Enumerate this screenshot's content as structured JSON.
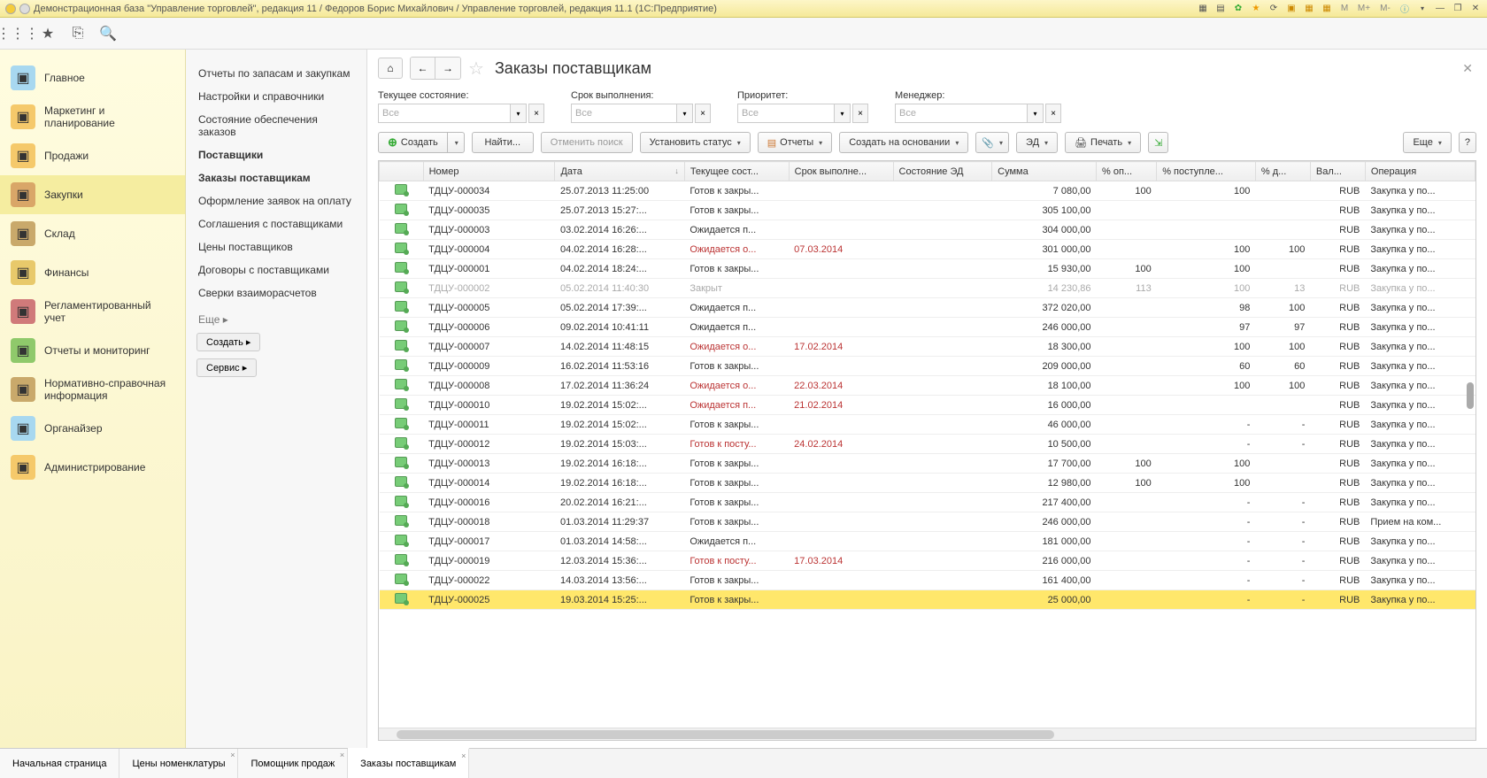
{
  "titlebar": {
    "text": "Демонстрационная база \"Управление торговлей\", редакция 11 / Федоров Борис Михайлович / Управление торговлей, редакция 11.1  (1С:Предприятие)",
    "m_labels": [
      "M",
      "M+",
      "M-"
    ]
  },
  "sidebar": [
    {
      "label": "Главное",
      "icon_bg": "#a8d8f0"
    },
    {
      "label": "Маркетинг и планирование",
      "icon_bg": "#f5c96b"
    },
    {
      "label": "Продажи",
      "icon_bg": "#f5c96b"
    },
    {
      "label": "Закупки",
      "icon_bg": "#d9a668",
      "active": true
    },
    {
      "label": "Склад",
      "icon_bg": "#c9a96b"
    },
    {
      "label": "Финансы",
      "icon_bg": "#e8c96b"
    },
    {
      "label": "Регламентированный учет",
      "icon_bg": "#d07a7a"
    },
    {
      "label": "Отчеты и мониторинг",
      "icon_bg": "#8fc96b"
    },
    {
      "label": "Нормативно-справочная информация",
      "icon_bg": "#c9a96b"
    },
    {
      "label": "Органайзер",
      "icon_bg": "#a8d8f0"
    },
    {
      "label": "Администрирование",
      "icon_bg": "#f5c96b"
    }
  ],
  "subpanel": {
    "links": [
      {
        "label": "Отчеты по запасам и закупкам"
      },
      {
        "label": "Настройки и справочники"
      },
      {
        "label": "Состояние обеспечения заказов"
      },
      {
        "label": "Поставщики",
        "bold": true
      },
      {
        "label": "Заказы поставщикам",
        "bold": true
      },
      {
        "label": "Оформление заявок на оплату"
      },
      {
        "label": "Соглашения с поставщиками"
      },
      {
        "label": "Цены поставщиков"
      },
      {
        "label": "Договоры с поставщиками"
      },
      {
        "label": "Сверки взаиморасчетов"
      }
    ],
    "more": "Еще ▸",
    "btn_create": "Создать ▸",
    "btn_service": "Сервис ▸"
  },
  "page": {
    "title": "Заказы поставщикам"
  },
  "filters": {
    "state": {
      "label": "Текущее состояние:",
      "value": "Все"
    },
    "deadline": {
      "label": "Срок выполнения:",
      "value": "Все"
    },
    "priority": {
      "label": "Приоритет:",
      "value": "Все"
    },
    "manager": {
      "label": "Менеджер:",
      "value": "Все"
    }
  },
  "actions": {
    "create": "Создать",
    "find": "Найти...",
    "cancel_search": "Отменить поиск",
    "set_status": "Установить статус",
    "reports": "Отчеты",
    "create_based": "Создать на основании",
    "ed": "ЭД",
    "print": "Печать",
    "more": "Еще",
    "help": "?"
  },
  "columns": [
    "",
    "Номер",
    "Дата",
    "Текущее сост...",
    "Срок выполне...",
    "Состояние ЭД",
    "Сумма",
    "% оп...",
    "% поступле...",
    "% д...",
    "Вал...",
    "Операция"
  ],
  "rows": [
    {
      "num": "ТДЦУ-000034",
      "date": "25.07.2013 11:25:00",
      "state": "Готов к закры...",
      "deadline": "",
      "ed": "",
      "sum": "7 080,00",
      "pct1": "100",
      "pct2": "100",
      "pct3": "",
      "cur": "RUB",
      "op": "Закупка у по..."
    },
    {
      "num": "ТДЦУ-000035",
      "date": "25.07.2013 15:27:...",
      "state": "Готов к закры...",
      "deadline": "",
      "ed": "",
      "sum": "305 100,00",
      "pct1": "",
      "pct2": "",
      "pct3": "",
      "cur": "RUB",
      "op": "Закупка у по..."
    },
    {
      "num": "ТДЦУ-000003",
      "date": "03.02.2014 16:26:...",
      "state": "Ожидается п...",
      "deadline": "",
      "ed": "",
      "sum": "304 000,00",
      "pct1": "",
      "pct2": "",
      "pct3": "",
      "cur": "RUB",
      "op": "Закупка у по..."
    },
    {
      "num": "ТДЦУ-000004",
      "date": "04.02.2014 16:28:...",
      "state": "Ожидается о...",
      "deadline": "07.03.2014",
      "ed": "",
      "sum": "301 000,00",
      "pct1": "",
      "pct2": "100",
      "pct3": "100",
      "cur": "RUB",
      "op": "Закупка у по...",
      "warn": true
    },
    {
      "num": "ТДЦУ-000001",
      "date": "04.02.2014 18:24:...",
      "state": "Готов к закры...",
      "deadline": "",
      "ed": "",
      "sum": "15 930,00",
      "pct1": "100",
      "pct2": "100",
      "pct3": "",
      "cur": "RUB",
      "op": "Закупка у по..."
    },
    {
      "num": "ТДЦУ-000002",
      "date": "05.02.2014 11:40:30",
      "state": "Закрыт",
      "deadline": "",
      "ed": "",
      "sum": "14 230,86",
      "pct1": "113",
      "pct2": "100",
      "pct3": "13",
      "cur": "RUB",
      "op": "Закупка у по...",
      "muted": true
    },
    {
      "num": "ТДЦУ-000005",
      "date": "05.02.2014 17:39:...",
      "state": "Ожидается п...",
      "deadline": "",
      "ed": "",
      "sum": "372 020,00",
      "pct1": "",
      "pct2": "98",
      "pct3": "100",
      "cur": "RUB",
      "op": "Закупка у по..."
    },
    {
      "num": "ТДЦУ-000006",
      "date": "09.02.2014 10:41:11",
      "state": "Ожидается п...",
      "deadline": "",
      "ed": "",
      "sum": "246 000,00",
      "pct1": "",
      "pct2": "97",
      "pct3": "97",
      "cur": "RUB",
      "op": "Закупка у по..."
    },
    {
      "num": "ТДЦУ-000007",
      "date": "14.02.2014 11:48:15",
      "state": "Ожидается о...",
      "deadline": "17.02.2014",
      "ed": "",
      "sum": "18 300,00",
      "pct1": "",
      "pct2": "100",
      "pct3": "100",
      "cur": "RUB",
      "op": "Закупка у по...",
      "warn": true
    },
    {
      "num": "ТДЦУ-000009",
      "date": "16.02.2014 11:53:16",
      "state": "Готов к закры...",
      "deadline": "",
      "ed": "",
      "sum": "209 000,00",
      "pct1": "",
      "pct2": "60",
      "pct3": "60",
      "cur": "RUB",
      "op": "Закупка у по..."
    },
    {
      "num": "ТДЦУ-000008",
      "date": "17.02.2014 11:36:24",
      "state": "Ожидается о...",
      "deadline": "22.03.2014",
      "ed": "",
      "sum": "18 100,00",
      "pct1": "",
      "pct2": "100",
      "pct3": "100",
      "cur": "RUB",
      "op": "Закупка у по...",
      "warn": true
    },
    {
      "num": "ТДЦУ-000010",
      "date": "19.02.2014 15:02:...",
      "state": "Ожидается п...",
      "deadline": "21.02.2014",
      "ed": "",
      "sum": "16 000,00",
      "pct1": "",
      "pct2": "",
      "pct3": "",
      "cur": "RUB",
      "op": "Закупка у по...",
      "warn": true
    },
    {
      "num": "ТДЦУ-000011",
      "date": "19.02.2014 15:02:...",
      "state": "Готов к закры...",
      "deadline": "",
      "ed": "",
      "sum": "46 000,00",
      "pct1": "",
      "pct2": "-",
      "pct3": "-",
      "cur": "RUB",
      "op": "Закупка у по..."
    },
    {
      "num": "ТДЦУ-000012",
      "date": "19.02.2014 15:03:...",
      "state": "Готов к посту...",
      "deadline": "24.02.2014",
      "ed": "",
      "sum": "10 500,00",
      "pct1": "",
      "pct2": "-",
      "pct3": "-",
      "cur": "RUB",
      "op": "Закупка у по...",
      "warn": true
    },
    {
      "num": "ТДЦУ-000013",
      "date": "19.02.2014 16:18:...",
      "state": "Готов к закры...",
      "deadline": "",
      "ed": "",
      "sum": "17 700,00",
      "pct1": "100",
      "pct2": "100",
      "pct3": "",
      "cur": "RUB",
      "op": "Закупка у по..."
    },
    {
      "num": "ТДЦУ-000014",
      "date": "19.02.2014 16:18:...",
      "state": "Готов к закры...",
      "deadline": "",
      "ed": "",
      "sum": "12 980,00",
      "pct1": "100",
      "pct2": "100",
      "pct3": "",
      "cur": "RUB",
      "op": "Закупка у по..."
    },
    {
      "num": "ТДЦУ-000016",
      "date": "20.02.2014 16:21:...",
      "state": "Готов к закры...",
      "deadline": "",
      "ed": "",
      "sum": "217 400,00",
      "pct1": "",
      "pct2": "-",
      "pct3": "-",
      "cur": "RUB",
      "op": "Закупка у по..."
    },
    {
      "num": "ТДЦУ-000018",
      "date": "01.03.2014 11:29:37",
      "state": "Готов к закры...",
      "deadline": "",
      "ed": "",
      "sum": "246 000,00",
      "pct1": "",
      "pct2": "-",
      "pct3": "-",
      "cur": "RUB",
      "op": "Прием на ком..."
    },
    {
      "num": "ТДЦУ-000017",
      "date": "01.03.2014 14:58:...",
      "state": "Ожидается п...",
      "deadline": "",
      "ed": "",
      "sum": "181 000,00",
      "pct1": "",
      "pct2": "-",
      "pct3": "-",
      "cur": "RUB",
      "op": "Закупка у по..."
    },
    {
      "num": "ТДЦУ-000019",
      "date": "12.03.2014 15:36:...",
      "state": "Готов к посту...",
      "deadline": "17.03.2014",
      "ed": "",
      "sum": "216 000,00",
      "pct1": "",
      "pct2": "-",
      "pct3": "-",
      "cur": "RUB",
      "op": "Закупка у по...",
      "warn": true
    },
    {
      "num": "ТДЦУ-000022",
      "date": "14.03.2014 13:56:...",
      "state": "Готов к закры...",
      "deadline": "",
      "ed": "",
      "sum": "161 400,00",
      "pct1": "",
      "pct2": "-",
      "pct3": "-",
      "cur": "RUB",
      "op": "Закупка у по..."
    },
    {
      "num": "ТДЦУ-000025",
      "date": "19.03.2014 15:25:...",
      "state": "Готов к закры...",
      "deadline": "",
      "ed": "",
      "sum": "25 000,00",
      "pct1": "",
      "pct2": "-",
      "pct3": "-",
      "cur": "RUB",
      "op": "Закупка у по...",
      "selected": true
    }
  ],
  "tabs": [
    {
      "label": "Начальная страница"
    },
    {
      "label": "Цены номенклатуры",
      "closable": true
    },
    {
      "label": "Помощник продаж",
      "closable": true
    },
    {
      "label": "Заказы поставщикам",
      "closable": true,
      "active": true
    }
  ]
}
